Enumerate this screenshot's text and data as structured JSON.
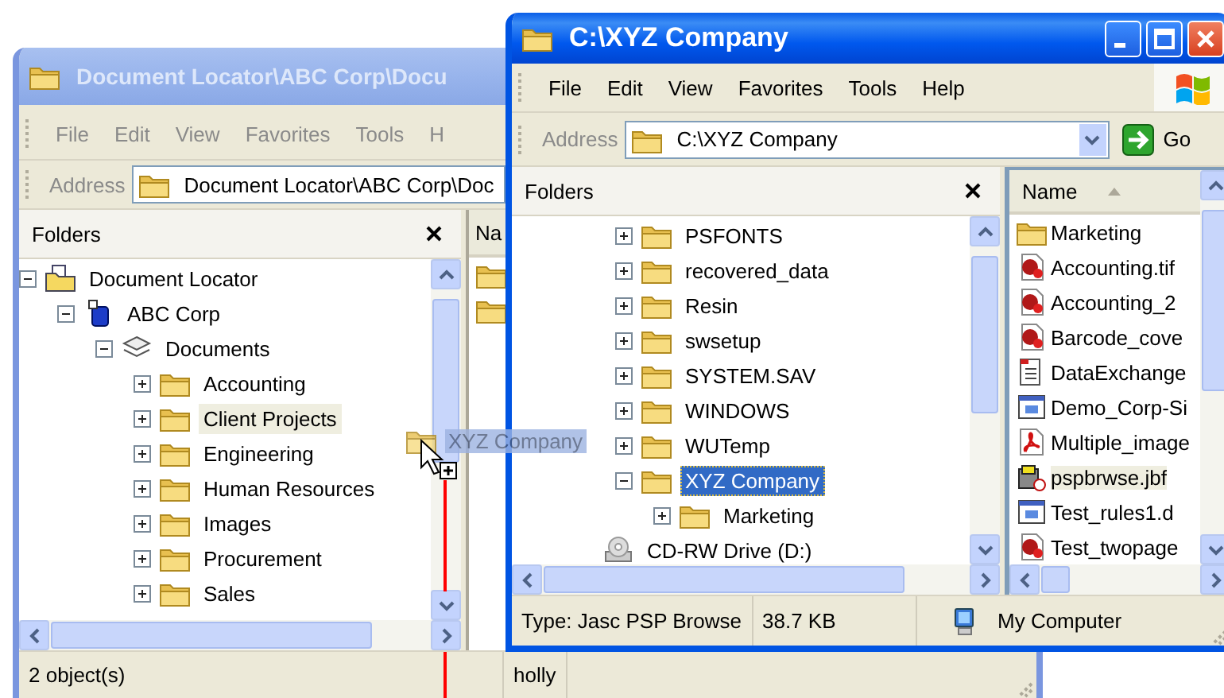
{
  "back_window": {
    "title": "Document Locator\\ABC Corp\\Docu",
    "active": false,
    "menu": [
      "File",
      "Edit",
      "View",
      "Favorites",
      "Tools",
      "H"
    ],
    "address_label": "Address",
    "address": "Document Locator\\ABC Corp\\Doc",
    "folders_title": "Folders",
    "tree": [
      {
        "label": "Document Locator",
        "kind": "locator",
        "expanded": true,
        "selected": false,
        "drop_target": false,
        "children": [
          {
            "label": "ABC Corp",
            "kind": "cabinet",
            "expanded": true,
            "selected": false,
            "drop_target": false,
            "children": [
              {
                "label": "Documents",
                "kind": "drawer",
                "expanded": true,
                "selected": false,
                "drop_target": false,
                "children": [
                  {
                    "label": "Accounting",
                    "kind": "folder",
                    "expanded": false,
                    "selected": false,
                    "drop_target": false
                  },
                  {
                    "label": "Client Projects",
                    "kind": "folder",
                    "expanded": false,
                    "selected": false,
                    "drop_target": true
                  },
                  {
                    "label": "Engineering",
                    "kind": "folder",
                    "expanded": false,
                    "selected": false,
                    "drop_target": false
                  },
                  {
                    "label": "Human Resources",
                    "kind": "folder",
                    "expanded": false,
                    "selected": false,
                    "drop_target": false
                  },
                  {
                    "label": "Images",
                    "kind": "folder",
                    "expanded": false,
                    "selected": false,
                    "drop_target": false
                  },
                  {
                    "label": "Procurement",
                    "kind": "folder",
                    "expanded": false,
                    "selected": false,
                    "drop_target": false
                  },
                  {
                    "label": "Sales",
                    "kind": "folder",
                    "expanded": false,
                    "selected": false,
                    "drop_target": false
                  }
                ]
              }
            ]
          }
        ]
      }
    ],
    "list_header": "Na",
    "files": [
      {
        "kind": "folder",
        "selected": false
      },
      {
        "kind": "folder",
        "selected": false
      }
    ],
    "status": [
      {
        "text": "2 object(s)"
      },
      {
        "text": "holly"
      }
    ]
  },
  "front_window": {
    "title": "C:\\XYZ Company",
    "active": true,
    "menu": [
      "File",
      "Edit",
      "View",
      "Favorites",
      "Tools",
      "Help"
    ],
    "address_label": "Address",
    "address": "C:\\XYZ Company",
    "go": "Go",
    "folders_title": "Folders",
    "tree": [
      {
        "children": [
          {
            "label": "PSFONTS",
            "kind": "folder",
            "expanded": false,
            "selected": false,
            "drop_target": false
          },
          {
            "label": "recovered_data",
            "kind": "folder",
            "expanded": false,
            "selected": false,
            "drop_target": false
          },
          {
            "label": "Resin",
            "kind": "folder",
            "expanded": false,
            "selected": false,
            "drop_target": false
          },
          {
            "label": "swsetup",
            "kind": "folder",
            "expanded": false,
            "selected": false,
            "drop_target": false
          },
          {
            "label": "SYSTEM.SAV",
            "kind": "folder",
            "expanded": false,
            "selected": false,
            "drop_target": false
          },
          {
            "label": "WINDOWS",
            "kind": "folder",
            "expanded": false,
            "selected": false,
            "drop_target": false
          },
          {
            "label": "WUTemp",
            "kind": "folder",
            "expanded": false,
            "selected": false,
            "drop_target": false
          },
          {
            "label": "XYZ Company",
            "kind": "folder",
            "expanded": true,
            "selected": true,
            "drop_target": false,
            "children": [
              {
                "label": "Marketing",
                "kind": "folder",
                "expanded": false,
                "selected": false,
                "drop_target": false
              }
            ]
          }
        ]
      },
      {
        "label": "CD-RW Drive (D:)",
        "kind": "cdrom",
        "selected": false,
        "drop_target": false
      }
    ],
    "list_header": "Name",
    "files": [
      {
        "name": "Marketing",
        "kind": "folder",
        "selected": false
      },
      {
        "name": "Accounting.tif",
        "kind": "image",
        "selected": false
      },
      {
        "name": "Accounting_2",
        "kind": "image",
        "selected": false
      },
      {
        "name": "Barcode_cove",
        "kind": "image",
        "selected": false
      },
      {
        "name": "DataExchange",
        "kind": "text-doc",
        "selected": false
      },
      {
        "name": "Demo_Corp-Si",
        "kind": "app-window",
        "selected": false
      },
      {
        "name": "Multiple_image",
        "kind": "pdf",
        "selected": false
      },
      {
        "name": "pspbrwse.jbf",
        "kind": "psp",
        "selected": true
      },
      {
        "name": "Test_rules1.d",
        "kind": "app-window",
        "selected": false
      },
      {
        "name": "Test_twopage",
        "kind": "image",
        "selected": false
      }
    ],
    "status": [
      {
        "text": "Type: Jasc PSP Browse"
      },
      {
        "text": "38.7 KB"
      },
      {
        "text": "My Computer",
        "kind": "computer"
      }
    ]
  },
  "drag": {
    "label": "XYZ Company"
  }
}
